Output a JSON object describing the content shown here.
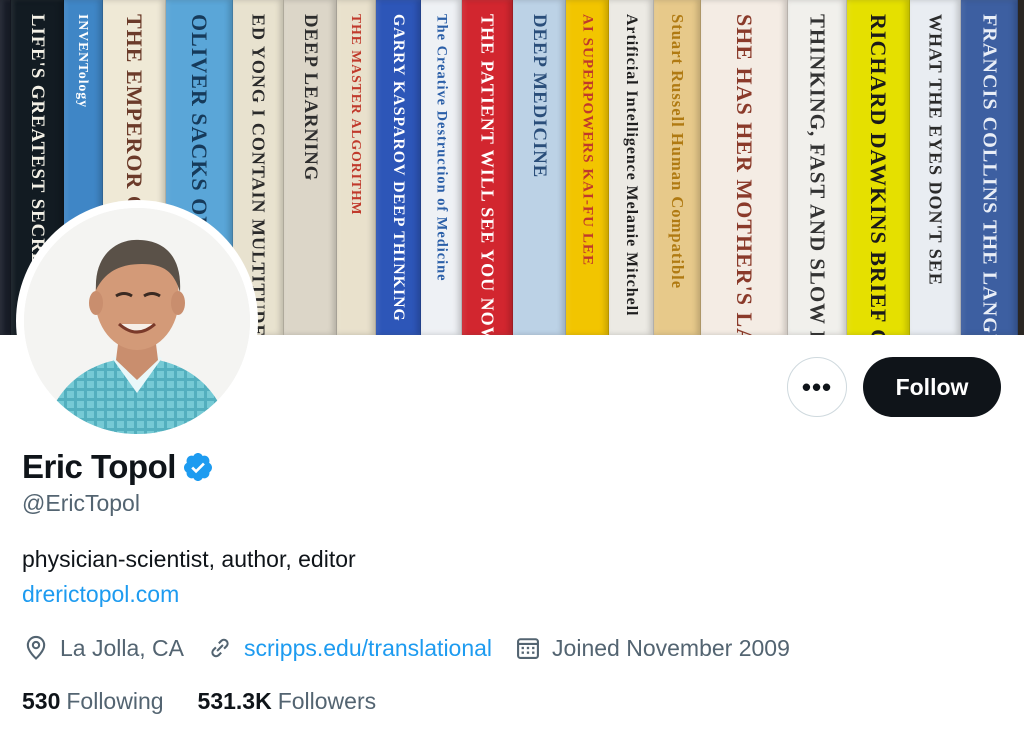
{
  "banner": {
    "books": [
      {
        "title": "",
        "bg": "#1a1f2b",
        "fg": "#e8e4d8",
        "w": 10
      },
      {
        "title": "LIFE'S GREATEST SECRET",
        "bg": "#121b22",
        "fg": "#f3f0e6",
        "w": 52
      },
      {
        "title": "INVENTology",
        "bg": "#3f86c6",
        "fg": "#ffffff",
        "w": 38
      },
      {
        "title": "THE EMPEROR OF ALL MALADIES",
        "bg": "#efe9d6",
        "fg": "#6b3b2a",
        "w": 62
      },
      {
        "title": "OLIVER SACKS ON THE MOVE",
        "bg": "#5aa6d8",
        "fg": "#163a5a",
        "w": 66
      },
      {
        "title": "ED YONG I CONTAIN MULTITUDES",
        "bg": "#e8e2cf",
        "fg": "#2a2a2a",
        "w": 50
      },
      {
        "title": "DEEP LEARNING",
        "bg": "#dcd6c8",
        "fg": "#2e2e2e",
        "w": 52
      },
      {
        "title": "THE MASTER ALGORITHM",
        "bg": "#e9e1cc",
        "fg": "#c0392b",
        "w": 38
      },
      {
        "title": "GARRY KASPAROV DEEP THINKING",
        "bg": "#2d56b8",
        "fg": "#ffffff",
        "w": 44
      },
      {
        "title": "The Creative Destruction of Medicine",
        "bg": "#eef1f5",
        "fg": "#2b5fa8",
        "w": 40
      },
      {
        "title": "THE PATIENT WILL SEE YOU NOW",
        "bg": "#d2262f",
        "fg": "#ffffff",
        "w": 50
      },
      {
        "title": "DEEP MEDICINE",
        "bg": "#bcd2e6",
        "fg": "#2a4e7a",
        "w": 52
      },
      {
        "title": "AI SUPERPOWERS KAI-FU LEE",
        "bg": "#f2c500",
        "fg": "#c0392b",
        "w": 42
      },
      {
        "title": "Artificial Intelligence Melanie Mitchell",
        "bg": "#eceae4",
        "fg": "#1f1f1f",
        "w": 44
      },
      {
        "title": "Stuart Russell Human Compatible",
        "bg": "#e7c98a",
        "fg": "#b07a12",
        "w": 46
      },
      {
        "title": "SHE HAS HER MOTHER'S LAUGH CARL ZIMMER",
        "bg": "#f4ece4",
        "fg": "#8a3a2a",
        "w": 86
      },
      {
        "title": "THINKING, FAST AND SLOW DANIEL KAHNEMAN",
        "bg": "#f1f0ec",
        "fg": "#333333",
        "w": 58
      },
      {
        "title": "RICHARD DAWKINS BRIEF CANDLE IN THE DARK",
        "bg": "#e5e000",
        "fg": "#1a1a1a",
        "w": 62
      },
      {
        "title": "WHAT THE EYES DON'T SEE",
        "bg": "#e9edf2",
        "fg": "#2b2b2b",
        "w": 50
      },
      {
        "title": "FRANCIS COLLINS THE LANGUAGE OF GOD",
        "bg": "#3d5fa1",
        "fg": "#e9eef7",
        "w": 56
      }
    ]
  },
  "profile": {
    "name": "Eric Topol",
    "handle": "@EricTopol",
    "bio": "physician-scientist, author, editor",
    "website": "drerictopol.com",
    "location": "La Jolla, CA",
    "url": "scripps.edu/translational",
    "joined": "Joined November 2009",
    "following_count": "530",
    "following_label": "Following",
    "followers_count": "531.3K",
    "followers_label": "Followers"
  },
  "actions": {
    "more_label": "•••",
    "follow_label": "Follow"
  },
  "colors": {
    "accent": "#1d9bf0",
    "text": "#0f1419",
    "secondary": "#536471"
  }
}
